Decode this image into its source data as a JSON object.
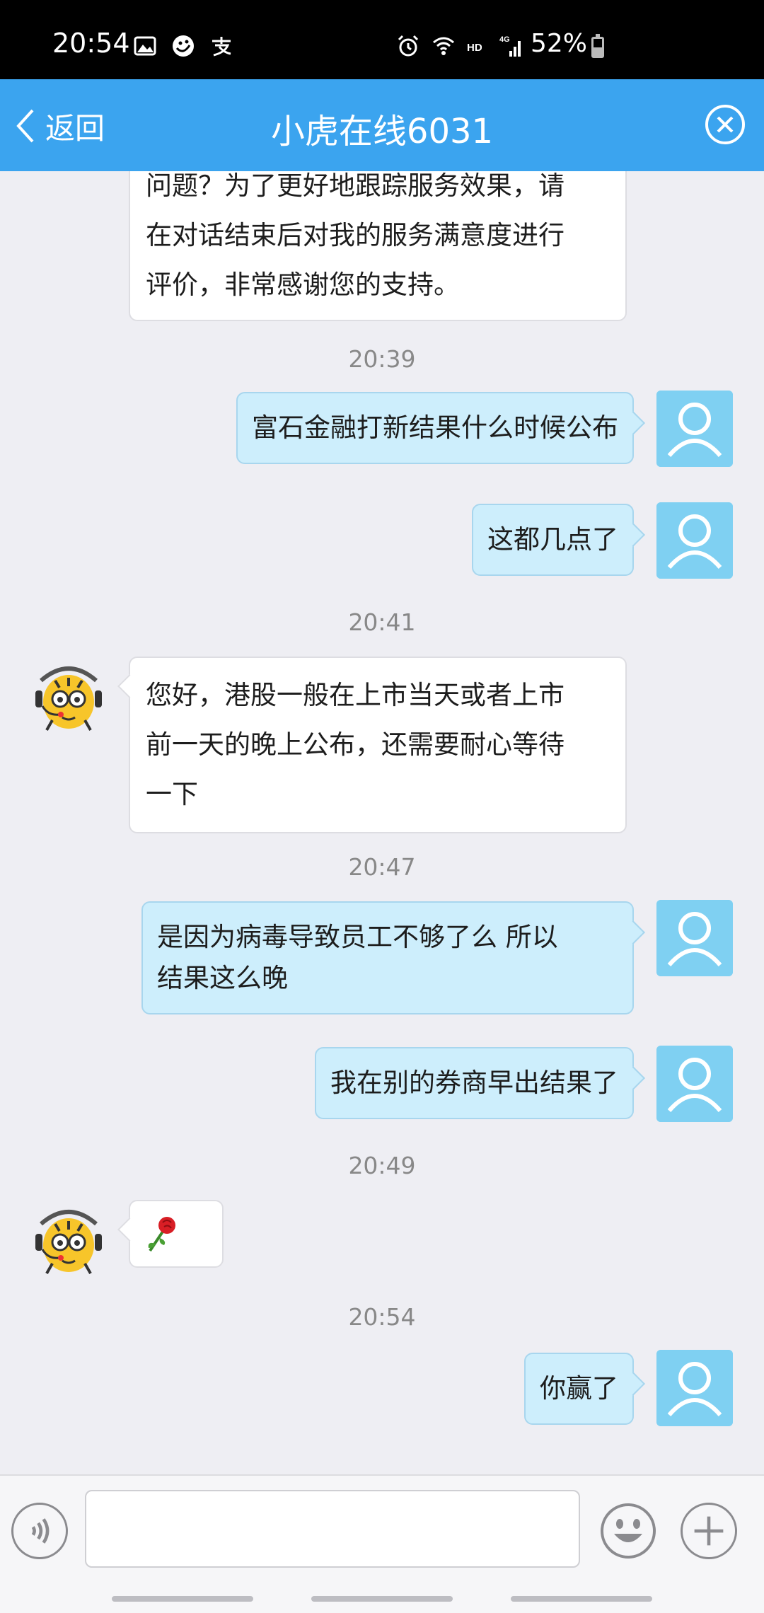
{
  "status_bar": {
    "time": "20:54",
    "battery_text": "52%",
    "battery_level": 0.52,
    "left_icons": [
      "gallery-icon",
      "app-icon",
      "alipay-icon"
    ],
    "right_icons": [
      "alarm-icon",
      "wifi-icon",
      "hd-icon",
      "4g-signal-icon"
    ]
  },
  "header": {
    "back_label": "返回",
    "title": "小虎在线6031",
    "accent": "#3ba4ef"
  },
  "messages": [
    {
      "side": "left",
      "avatar": false,
      "lines": [
        "问题？为了更好地跟踪服务效果，请",
        "在对话结束后对我的服务满意度进行",
        "评价，非常感谢您的支持。"
      ]
    },
    {
      "time": "20:39"
    },
    {
      "side": "right",
      "text": "富石金融打新结果什么时候公布"
    },
    {
      "side": "right",
      "text": "这都几点了"
    },
    {
      "time": "20:41"
    },
    {
      "side": "left",
      "avatar": true,
      "lines": [
        "您好，港股一般在上市当天或者上市",
        "前一天的晚上公布，还需要耐心等待",
        "一下"
      ]
    },
    {
      "time": "20:47"
    },
    {
      "side": "right",
      "lines": [
        "是因为病毒导致员工不够了么 所以",
        "结果这么晚"
      ]
    },
    {
      "side": "right",
      "text": "我在别的券商早出结果了"
    },
    {
      "time": "20:49"
    },
    {
      "side": "left",
      "avatar": true,
      "emoji": "rose-emoji"
    },
    {
      "time": "20:54"
    },
    {
      "side": "right",
      "text": "你赢了"
    }
  ],
  "input_bar": {
    "placeholder": "",
    "voice_icon": "voice-icon",
    "emoji_icon": "emoji-icon",
    "plus_icon": "plus-icon"
  },
  "colors": {
    "user_bubble": "#cdeefc",
    "user_avatar": "#7fd0f2",
    "chat_background": "#eeeef3"
  }
}
